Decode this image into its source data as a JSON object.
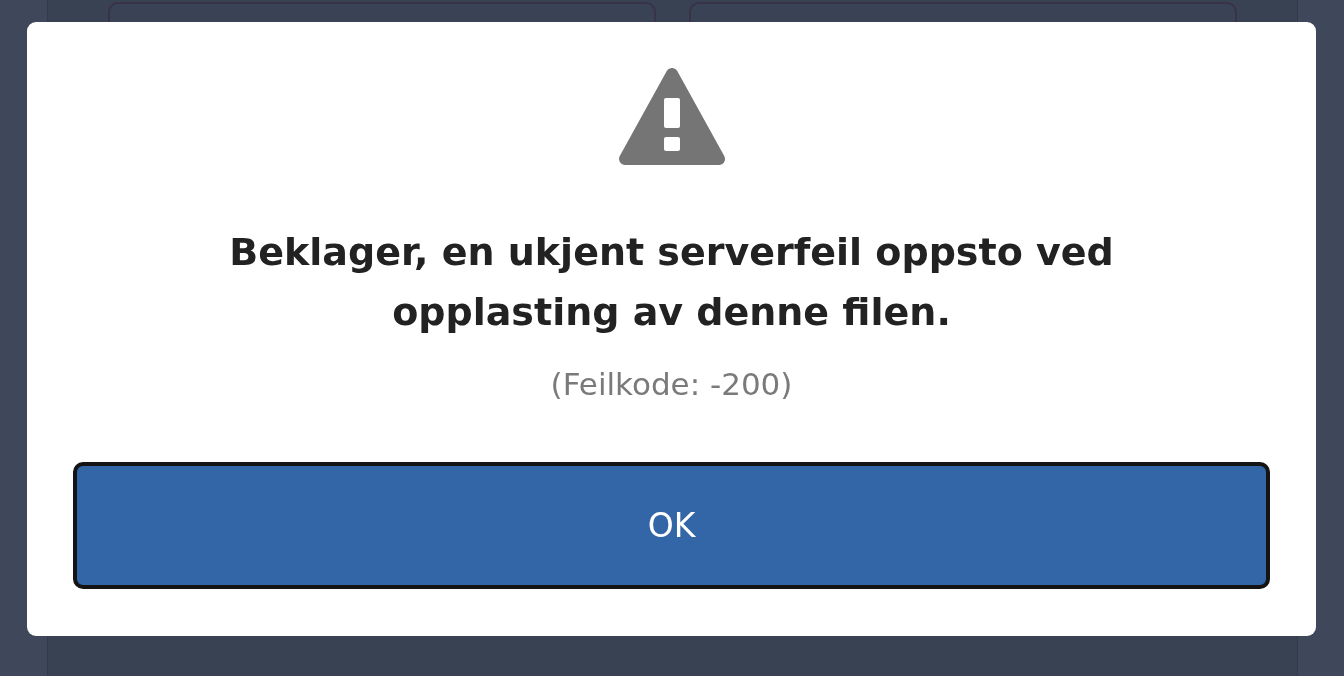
{
  "dialog": {
    "message": "Beklager, en ukjent serverfeil oppsto ved opplasting av denne filen.",
    "error_code": "(Feilkode: -200)",
    "buttons": [
      "OK"
    ]
  }
}
